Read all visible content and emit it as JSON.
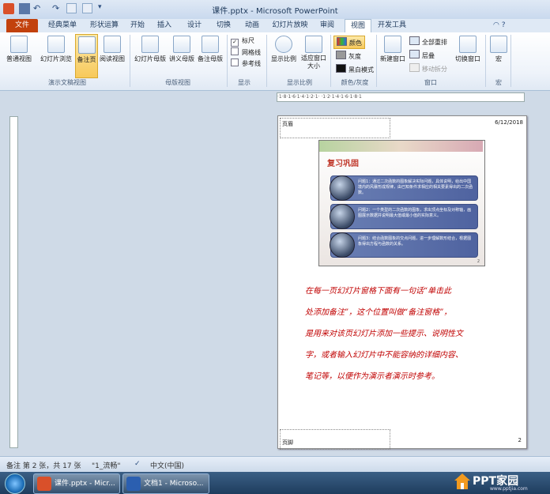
{
  "window": {
    "title": "课件.pptx - Microsoft PowerPoint"
  },
  "tabs": [
    "文件",
    "经典菜单",
    "形状运算",
    "开始",
    "插入",
    "设计",
    "切换",
    "动画",
    "幻灯片放映",
    "审阅",
    "视图",
    "开发工具"
  ],
  "active_tab": "视图",
  "ribbon": {
    "presentation_views": {
      "label": "演示文稿视图",
      "buttons": [
        "普通视图",
        "幻灯片浏览",
        "备注页",
        "阅读视图"
      ],
      "selected": "备注页"
    },
    "master_views": {
      "label": "母版视图",
      "buttons": [
        "幻灯片母版",
        "讲义母版",
        "备注母版"
      ]
    },
    "show": {
      "label": "显示",
      "items": [
        {
          "label": "标尺",
          "checked": true
        },
        {
          "label": "网格线",
          "checked": false
        },
        {
          "label": "参考线",
          "checked": false
        }
      ]
    },
    "zoom": {
      "label": "显示比例",
      "buttons": [
        "显示比例",
        "适应窗口大小"
      ]
    },
    "color": {
      "label": "颜色/灰度",
      "items": [
        "颜色",
        "灰度",
        "黑白模式"
      ]
    },
    "window": {
      "label": "窗口",
      "new_window": "新建窗口",
      "arrange_all": "全部重排",
      "cascade": "层叠",
      "move_split": "移动拆分",
      "switch": "切换窗口"
    },
    "macro": {
      "label": "宏",
      "button": "宏"
    }
  },
  "ruler": {
    "horizontal": "·1·8·1·6·1·4·1·2·1· ·1·2·1·4·1·6·1·8·1"
  },
  "notes_page": {
    "header": "页眉",
    "date": "6/12/2018",
    "footer": "页脚",
    "page_number": "2",
    "slide": {
      "title": "复习巩固",
      "questions": [
        "问题1：通过二次函数的图象解决实际问题，具体说明，给出中国境内的风暴形成规律，由已知条件求相应的相关要素得出的二次函数。",
        "问题2：一个类型的二次函数的图象，求出顶点坐标及对称轴，画图展示数据并说明最大值或最小值的实际意义。",
        "问题3：结合函数图象的交点问题，进一步理解数形结合，根据图象得出方程与函数的关系。"
      ],
      "slide_number": "2"
    },
    "notes_text": [
      "在每一页幻灯片窗格下面有一句话“单击此",
      "处添加备注”，这个位置叫做“备注窗格”，",
      "是用来对该页幻灯片添加一些提示、说明性文",
      "字，或者输入幻灯片中不能容纳的详细内容、",
      "笔记等，以便作为演示者演示时参考。"
    ]
  },
  "status_bar": {
    "page": "备注 第 2 张，共 17 张",
    "theme": "\"1_流畅\"",
    "language": "中文(中国)"
  },
  "taskbar": {
    "items": [
      "课件.pptx - Micr...",
      "文档1 - Microso..."
    ],
    "watermark": "PPT家园",
    "watermark_url": "www.pptjia.com"
  },
  "colors": {
    "file_tab": "#c2410c",
    "notes_text": "#c00000",
    "accent": "#f7c95b"
  }
}
